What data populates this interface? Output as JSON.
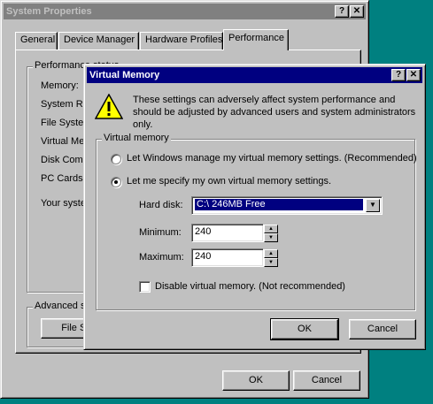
{
  "system_properties": {
    "title": "System Properties",
    "help_btn": "?",
    "close_btn": "✕",
    "tabs": [
      {
        "label": "General"
      },
      {
        "label": "Device Manager"
      },
      {
        "label": "Hardware Profiles"
      },
      {
        "label": "Performance"
      }
    ],
    "performance_status_label": "Performance status",
    "status_rows": [
      {
        "label": "Memory:"
      },
      {
        "label": "System Re"
      },
      {
        "label": "File Syster"
      },
      {
        "label": "Virtual Mer"
      },
      {
        "label": "Disk Comp"
      },
      {
        "label": "PC Cards (I"
      },
      {
        "label": "Your syster"
      }
    ],
    "advanced_label": "Advanced s",
    "file_system_btn": "File Sy",
    "ok": "OK",
    "cancel": "Cancel"
  },
  "virtual_memory": {
    "title": "Virtual Memory",
    "help_btn": "?",
    "close_btn": "✕",
    "warning_icon": "warning-icon",
    "warning_text": "These settings can adversely affect system performance and should be adjusted by advanced users and system administrators only.",
    "group_label": "Virtual memory",
    "radio_windows_manage": "Let Windows manage my virtual memory settings. (Recommended)",
    "radio_specify_own": "Let me specify my own virtual memory settings.",
    "selected_option": "specify_own",
    "hard_disk_label": "Hard disk:",
    "hard_disk_value": "C:\\ 246MB Free",
    "minimum_label": "Minimum:",
    "minimum_value": "240",
    "maximum_label": "Maximum:",
    "maximum_value": "240",
    "disable_label": "Disable virtual memory. (Not recommended)",
    "disable_checked": false,
    "ok": "OK",
    "cancel": "Cancel"
  },
  "colors": {
    "desktop": "#008080",
    "active_title": "#000080",
    "inactive_title": "#808080",
    "face": "#c0c0c0"
  }
}
